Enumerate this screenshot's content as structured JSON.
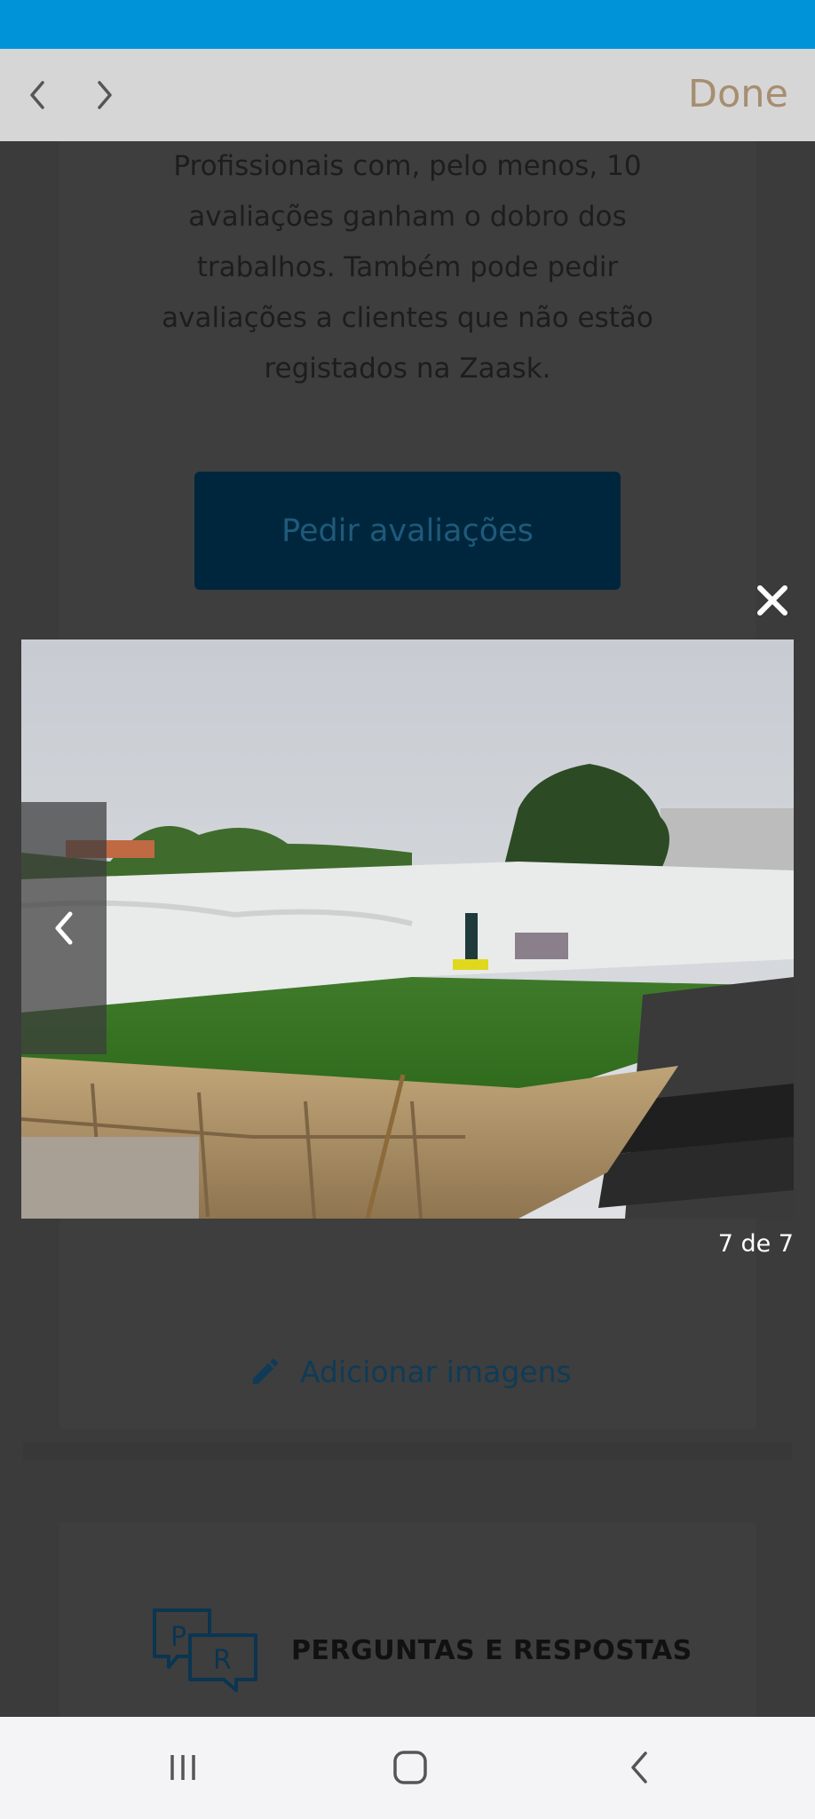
{
  "browser": {
    "done_label": "Done"
  },
  "page": {
    "info_text_lines": [
      "Profissionais com, pelo menos, 10",
      "avaliações ganham o dobro dos",
      "trabalhos. Também pode pedir",
      "avaliações a clientes que não estão",
      "registados na Zaask."
    ],
    "ask_reviews_label": "Pedir avaliações",
    "add_images_label": "Adicionar imagens",
    "qa_icon_letters": [
      "P",
      "R"
    ],
    "qa_title": "PERGUNTAS E RESPOSTAS"
  },
  "gallery": {
    "counter": "7 de 7"
  },
  "icons": {
    "back": "chevron-left-icon",
    "forward": "chevron-right-icon",
    "close": "close-icon",
    "pencil": "pencil-icon",
    "qa": "speech-bubbles-icon",
    "recents": "recents-icon",
    "home": "home-icon",
    "system_back": "back-icon"
  },
  "colors": {
    "status_bar": "#0093d8",
    "toolbar": "#d6d6d6",
    "done": "#a68e70",
    "overlay_page": "#3b3b3b",
    "button": "#00263d"
  }
}
